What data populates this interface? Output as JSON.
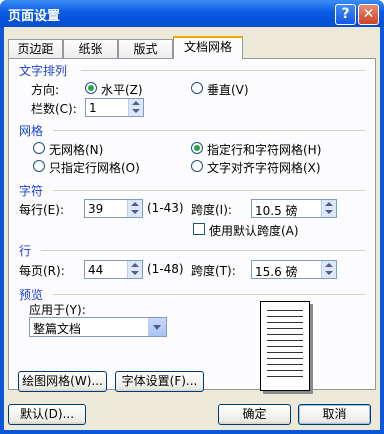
{
  "window": {
    "title": "页面设置",
    "help_glyph": "?",
    "close_glyph": "✕"
  },
  "tabs": [
    {
      "label": "页边距",
      "active": false
    },
    {
      "label": "纸张",
      "active": false
    },
    {
      "label": "版式",
      "active": false
    },
    {
      "label": "文档网格",
      "active": true
    }
  ],
  "text_direction": {
    "heading": "文字排列",
    "direction_label": "方向:",
    "options": [
      {
        "label": "水平(Z)",
        "selected": true
      },
      {
        "label": "垂直(V)",
        "selected": false
      }
    ],
    "columns_label": "栏数(C):",
    "columns_value": "1"
  },
  "grid": {
    "heading": "网格",
    "options": [
      {
        "label": "无网格(N)",
        "selected": false
      },
      {
        "label": "指定行和字符网格(H)",
        "selected": true
      },
      {
        "label": "只指定行网格(O)",
        "selected": false
      },
      {
        "label": "文字对齐字符网格(X)",
        "selected": false
      }
    ]
  },
  "characters": {
    "heading": "字符",
    "per_line_label": "每行(E):",
    "per_line_value": "39",
    "range": "(1-43)",
    "pitch_label": "跨度(I):",
    "pitch_value": "10.5 磅",
    "default_pitch_label": "使用默认跨度(A)",
    "default_pitch_checked": false
  },
  "lines": {
    "heading": "行",
    "per_page_label": "每页(R):",
    "per_page_value": "44",
    "range": "(1-48)",
    "pitch_label": "跨度(T):",
    "pitch_value": "15.6 磅"
  },
  "preview": {
    "heading": "预览",
    "apply_label": "应用于(Y):",
    "apply_value": "整篇文档"
  },
  "buttons": {
    "draw_grid": "绘图网格(W)...",
    "font_settings": "字体设置(F)...",
    "default": "默认(D)...",
    "ok": "确定",
    "cancel": "取消"
  },
  "colors": {
    "title_bar": "#0a5ce5",
    "section_heading": "#1c3fd8",
    "dialog_face": "#ece9d8"
  }
}
